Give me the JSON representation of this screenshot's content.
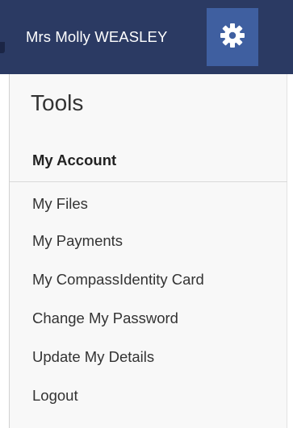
{
  "header": {
    "user_name": "Mrs Molly WEASLEY",
    "settings_icon": "gear-icon",
    "accent_color": "#3f5fa0",
    "bar_color": "#2b3a63"
  },
  "menu": {
    "title": "Tools",
    "items": [
      {
        "label": "My Account",
        "active": true
      },
      {
        "label": "My Files",
        "active": false
      },
      {
        "label": "My Payments",
        "active": false
      },
      {
        "label": "My CompassIdentity Card",
        "active": false
      },
      {
        "label": "Change My Password",
        "active": false
      },
      {
        "label": "Update My Details",
        "active": false
      },
      {
        "label": "Logout",
        "active": false
      }
    ]
  }
}
